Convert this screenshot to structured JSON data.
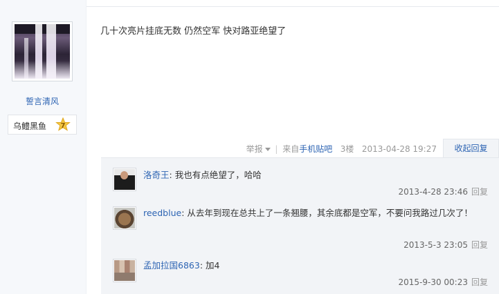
{
  "author": {
    "avatar_icon": "waterfall-avatar",
    "name": "誓言清风",
    "badge_label": "乌鳢黑鱼",
    "badge_level": "7"
  },
  "post": {
    "content": "几十次亮片挂底无数 仍然空军 快对路亚绝望了",
    "report_label": "举报",
    "source_prefix": "来自",
    "source_link": "手机贴吧",
    "floor": "3楼",
    "time": "2013-04-28 19:27",
    "collapse_label": "收起回复"
  },
  "comments": [
    {
      "user": "洛奇王",
      "text": ": 我也有点绝望了，哈哈",
      "time": "2013-4-28 23:46",
      "reply_label": "回复",
      "avatar_icon": "man-avatar"
    },
    {
      "user": "reedblue",
      "text": ": 从去年到现在总共上了一条翘腰，其余底都是空军，不要问我路过几次了！",
      "time": "2013-5-3 23:05",
      "reply_label": "回复",
      "avatar_icon": "dog-avatar"
    },
    {
      "user": "孟加拉国6863",
      "text": ": 加4",
      "time": "2015-9-30 00:23",
      "reply_label": "回复",
      "avatar_icon": "group-avatar"
    }
  ],
  "colors": {
    "link": "#2d64b3",
    "panel_bg": "#f2f4f7",
    "sidebar_bg": "#f6f8fb",
    "badge_star": "#f5c842"
  }
}
